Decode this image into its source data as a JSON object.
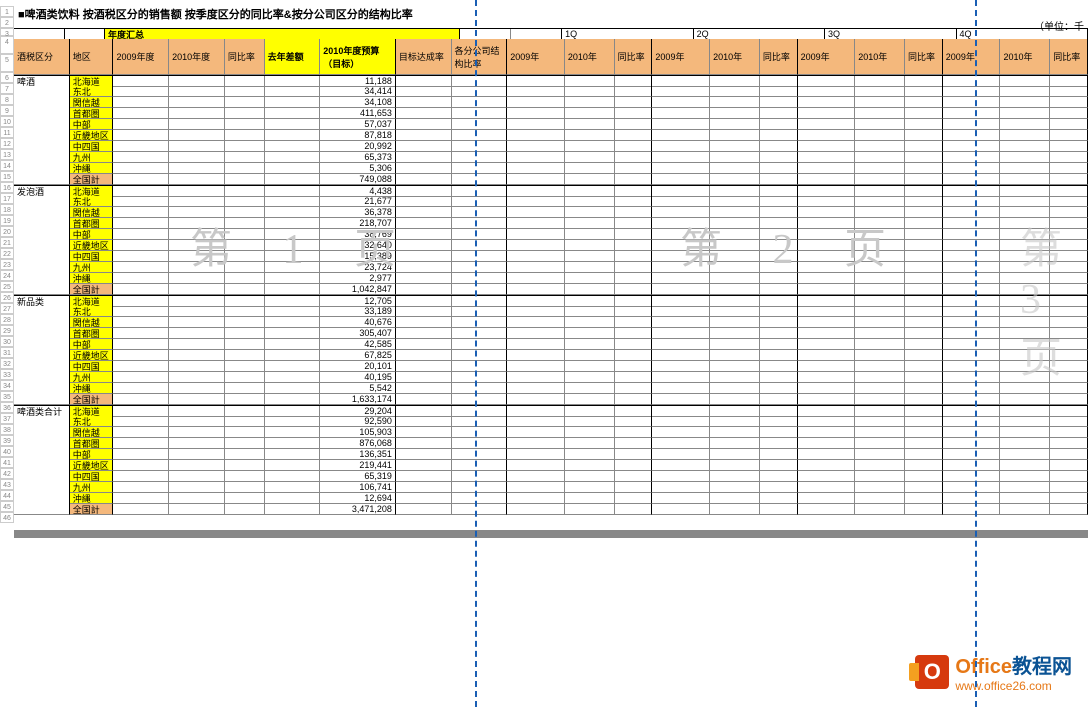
{
  "title": "■啤酒类饮料 按酒税区分的销售额 按季度区分的同比率&按分公司区分的结构比率",
  "unit_label": "（单位：千",
  "annual_group_label": "年度汇总",
  "quarter_labels": [
    "1Q",
    "2Q",
    "3Q",
    "4Q"
  ],
  "headers": {
    "tax_class": "酒税区分",
    "region": "地区",
    "y2009": "2009年度",
    "y2010": "2010年度",
    "yoy": "同比率",
    "last_year_diff": "去年差额",
    "budget_2010": "2010年度预算（目标）",
    "target_achieve": "目标达成率",
    "branch_struct": "各分公司结构比率",
    "q2009": "2009年",
    "q2010": "2010年",
    "qyoy": "同比率"
  },
  "watermarks": {
    "p1": "第 1 页",
    "p2": "第 2 页",
    "p3": "第 3 页"
  },
  "logo": {
    "title_a": "Office",
    "title_b": "教程网",
    "url": "www.office26.com"
  },
  "row_numbers": [
    1,
    2,
    3,
    4,
    5,
    6,
    7,
    8,
    9,
    10,
    11,
    12,
    13,
    14,
    15,
    16,
    17,
    18,
    19,
    20,
    21,
    22,
    23,
    24,
    25,
    26,
    27,
    28,
    29,
    30,
    31,
    32,
    33,
    34,
    35,
    36,
    37,
    38,
    39,
    40,
    41,
    42,
    43,
    44,
    45,
    46
  ],
  "categories": [
    {
      "name": "啤酒",
      "rows": [
        {
          "region": "北海道",
          "budget": "11,188"
        },
        {
          "region": "东北",
          "budget": "34,414"
        },
        {
          "region": "関信越",
          "budget": "34,108"
        },
        {
          "region": "首都圏",
          "budget": "411,653"
        },
        {
          "region": "中部",
          "budget": "57,037"
        },
        {
          "region": "近畿地区",
          "budget": "87,818"
        },
        {
          "region": "中四国",
          "budget": "20,992"
        },
        {
          "region": "九州",
          "budget": "65,373"
        },
        {
          "region": "沖縄",
          "budget": "5,306"
        },
        {
          "region": "全国計",
          "budget": "749,088",
          "total": true
        }
      ]
    },
    {
      "name": "发泡酒",
      "rows": [
        {
          "region": "北海道",
          "budget": "4,438"
        },
        {
          "region": "东北",
          "budget": "21,677"
        },
        {
          "region": "関信越",
          "budget": "36,378"
        },
        {
          "region": "首都圏",
          "budget": "218,707"
        },
        {
          "region": "中部",
          "budget": "38,769"
        },
        {
          "region": "近畿地区",
          "budget": "32,640"
        },
        {
          "region": "中四国",
          "budget": "15,389"
        },
        {
          "region": "九州",
          "budget": "23,724"
        },
        {
          "region": "沖縄",
          "budget": "2,977"
        },
        {
          "region": "全国計",
          "budget": "1,042,847",
          "total": true
        }
      ]
    },
    {
      "name": "新品类",
      "rows": [
        {
          "region": "北海道",
          "budget": "12,705"
        },
        {
          "region": "东北",
          "budget": "33,189"
        },
        {
          "region": "関信越",
          "budget": "40,676"
        },
        {
          "region": "首都圏",
          "budget": "305,407"
        },
        {
          "region": "中部",
          "budget": "42,585"
        },
        {
          "region": "近畿地区",
          "budget": "67,825"
        },
        {
          "region": "中四国",
          "budget": "20,101"
        },
        {
          "region": "九州",
          "budget": "40,195"
        },
        {
          "region": "沖縄",
          "budget": "5,542"
        },
        {
          "region": "全国計",
          "budget": "1,633,174",
          "total": true
        }
      ]
    },
    {
      "name": "啤酒类合计",
      "rows": [
        {
          "region": "北海道",
          "budget": "29,204"
        },
        {
          "region": "东北",
          "budget": "92,590"
        },
        {
          "region": "関信越",
          "budget": "105,903"
        },
        {
          "region": "首都圏",
          "budget": "876,068"
        },
        {
          "region": "中部",
          "budget": "136,351"
        },
        {
          "region": "近畿地区",
          "budget": "219,441"
        },
        {
          "region": "中四国",
          "budget": "65,319"
        },
        {
          "region": "九州",
          "budget": "106,741"
        },
        {
          "region": "沖縄",
          "budget": "12,694"
        },
        {
          "region": "全国計",
          "budget": "3,471,208",
          "total": true
        }
      ]
    }
  ]
}
